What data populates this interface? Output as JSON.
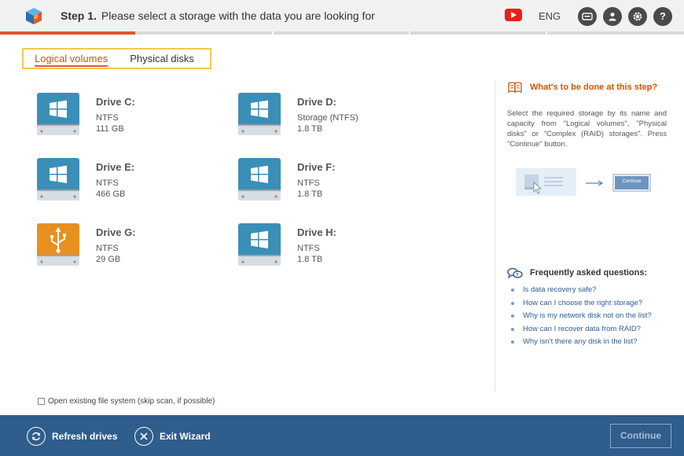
{
  "header": {
    "step_label": "Step 1.",
    "step_text": "Please select a storage with the data you are looking for",
    "language": "ENG",
    "help_button": "?"
  },
  "tabs": [
    {
      "label": "Logical volumes",
      "active": true
    },
    {
      "label": "Physical disks",
      "active": false
    }
  ],
  "drives": [
    {
      "name": "Drive C:",
      "fs": "NTFS",
      "size": "111 GB",
      "type": "windows"
    },
    {
      "name": "Drive D:",
      "fs": "Storage (NTFS)",
      "size": "1.8 TB",
      "type": "windows"
    },
    {
      "name": "Drive E:",
      "fs": "NTFS",
      "size": "466 GB",
      "type": "windows"
    },
    {
      "name": "Drive F:",
      "fs": "NTFS",
      "size": "1.8 TB",
      "type": "windows"
    },
    {
      "name": "Drive G:",
      "fs": "NTFS",
      "size": "29 GB",
      "type": "usb"
    },
    {
      "name": "Drive H:",
      "fs": "NTFS",
      "size": "1.8 TB",
      "type": "windows"
    }
  ],
  "checkbox_label": "Open existing file system (skip scan, if possible)",
  "help": {
    "title": "What's to be done at this step?",
    "text": "Select the required storage by its name and capacity from \"Logical volumes\", \"Physical disks\" or \"Complex (RAID) storages\". Press \"Continue\" button.",
    "illus_button": "Continue"
  },
  "faq": {
    "title": "Frequently asked questions:",
    "items": [
      "Is data recovery safe?",
      "How can I choose the right storage?",
      "Why is my network disk not on the list?",
      "How can I recover data from RAID?",
      "Why isn't there any disk in the list?"
    ]
  },
  "footer": {
    "refresh": "Refresh drives",
    "exit": "Exit Wizard",
    "continue": "Continue"
  },
  "colors": {
    "accent": "#e2562b",
    "footer": "#2f5d8c",
    "drive_blue": "#3a8fb7",
    "drive_orange": "#e8901f"
  }
}
